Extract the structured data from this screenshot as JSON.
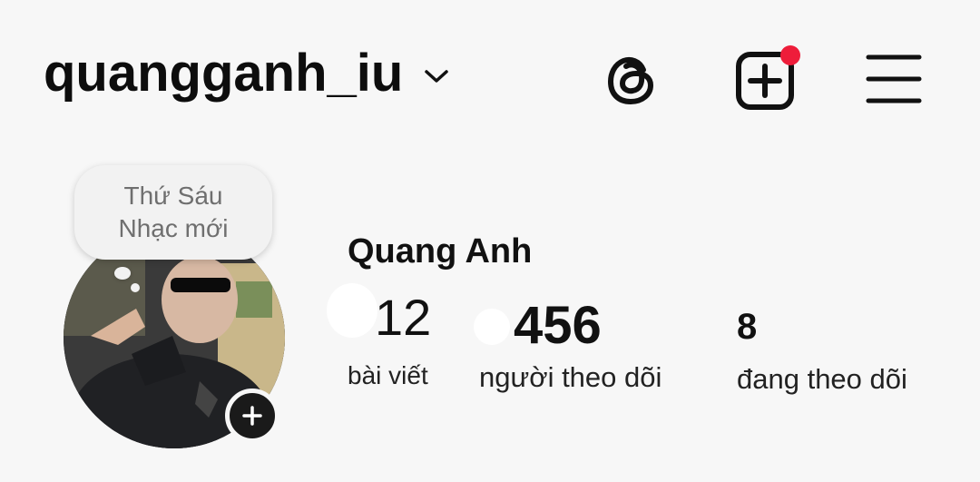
{
  "header": {
    "username": "quangganh_iu",
    "icons": [
      "chevron-down-icon",
      "threads-icon",
      "create-post-icon",
      "menu-icon"
    ],
    "notification_color": "#ee1d3a"
  },
  "note": {
    "line1": "Thứ Sáu",
    "line2": "Nhạc mới"
  },
  "profile": {
    "display_name": "Quang Anh",
    "stats": [
      {
        "value": "12",
        "label": "bài viết"
      },
      {
        "value": "456",
        "label": "người theo dõi"
      },
      {
        "value": "8",
        "label": "đang theo dõi"
      }
    ]
  }
}
